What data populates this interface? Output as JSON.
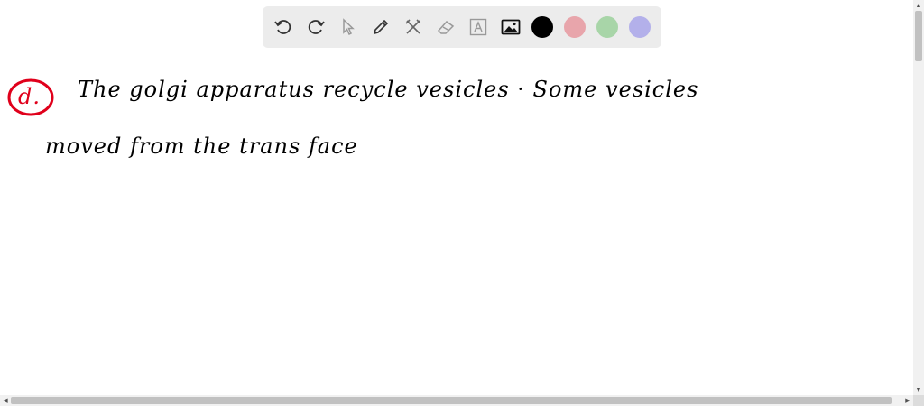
{
  "toolbar": {
    "tools": [
      "undo-icon",
      "redo-icon",
      "select-icon",
      "pen-icon",
      "tools-icon",
      "eraser-icon",
      "text-icon",
      "image-icon"
    ],
    "colors": [
      "#000000",
      "#e8a5ab",
      "#a8d5a8",
      "#b3b0ea"
    ]
  },
  "canvas": {
    "ink_color": "#000000",
    "label_color": "#e0001b",
    "label": "d.",
    "lines": [
      "The golgi apparatus recycle vesicles · Some vesicles",
      "moved from the trans face"
    ]
  }
}
